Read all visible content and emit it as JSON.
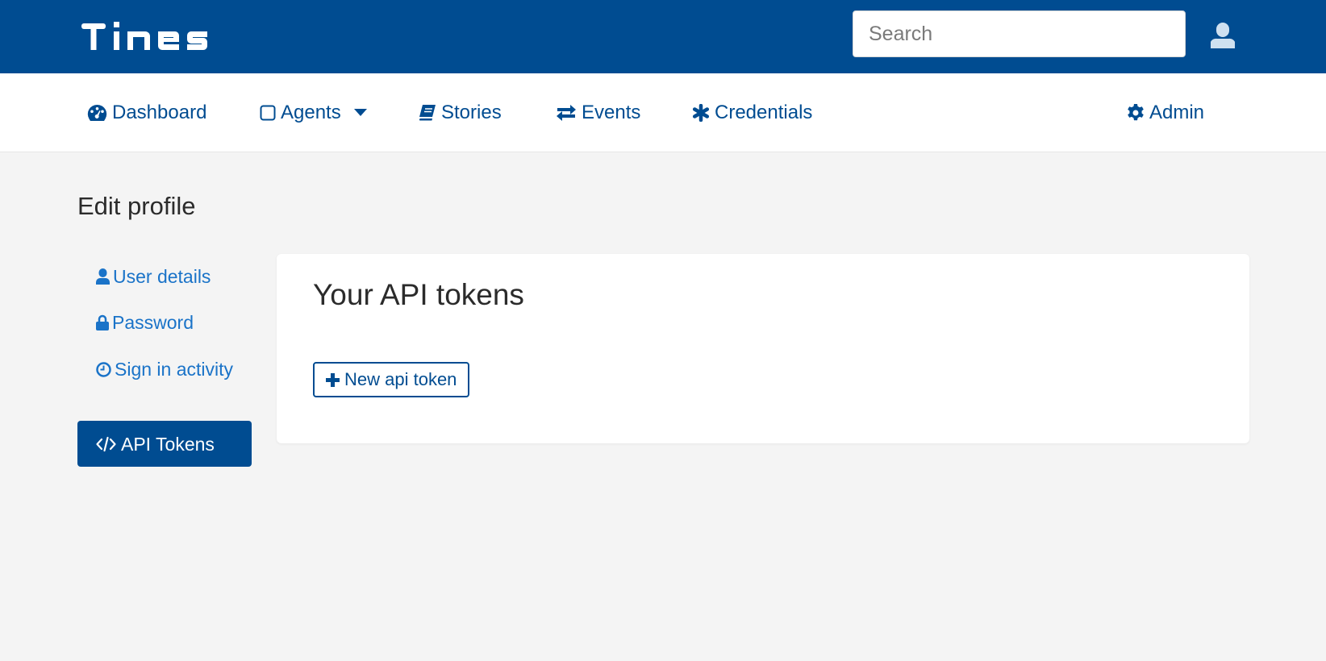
{
  "app": {
    "logo_text": "Tines",
    "brand_color": "#004c91",
    "link_color": "#1a73c8"
  },
  "header": {
    "search": {
      "placeholder": "Search",
      "value": ""
    },
    "user_icon": "user-icon"
  },
  "nav": {
    "items": [
      {
        "label": "Dashboard",
        "icon": "tachometer-icon"
      },
      {
        "label": "Agents",
        "icon": "square-icon",
        "has_dropdown": true
      },
      {
        "label": "Stories",
        "icon": "book-icon"
      },
      {
        "label": "Events",
        "icon": "exchange-icon"
      },
      {
        "label": "Credentials",
        "icon": "asterisk-icon"
      }
    ],
    "admin": {
      "label": "Admin",
      "icon": "gear-icon"
    }
  },
  "page": {
    "title": "Edit profile"
  },
  "sidebar": {
    "items": [
      {
        "label": "User details",
        "icon": "user-icon",
        "active": false
      },
      {
        "label": "Password",
        "icon": "lock-icon",
        "active": false
      },
      {
        "label": "Sign in activity",
        "icon": "clock-icon",
        "active": false
      },
      {
        "label": "API Tokens",
        "icon": "code-icon",
        "active": true
      }
    ]
  },
  "main": {
    "title": "Your API tokens",
    "new_token_label": "New api token"
  }
}
